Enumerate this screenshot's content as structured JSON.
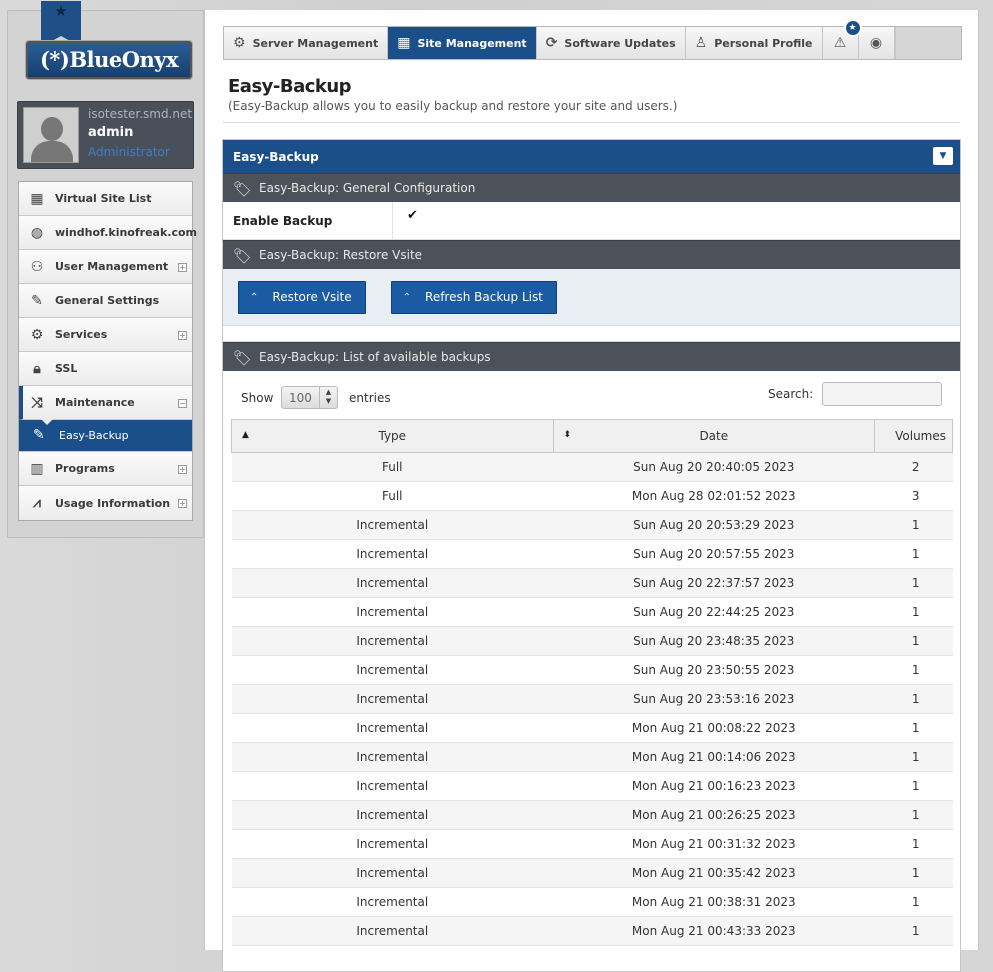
{
  "logo": {
    "text": "(*)BlueOnyx"
  },
  "user": {
    "host": "isotester.smd.net",
    "name": "admin",
    "role": "Administrator"
  },
  "sidebar": {
    "items": [
      {
        "label": "Virtual Site List",
        "icon": "grid-list-icon"
      },
      {
        "label": "windhof.kinofreak.com",
        "icon": "globe-icon"
      },
      {
        "label": "User Management",
        "icon": "users-icon"
      },
      {
        "label": "General Settings",
        "icon": "edit-square-icon"
      },
      {
        "label": "Services",
        "icon": "gear-icon"
      },
      {
        "label": "SSL",
        "icon": "lock-icon"
      },
      {
        "label": "Maintenance",
        "icon": "shuffle-icon"
      },
      {
        "label": "Easy-Backup",
        "icon": "pencil-icon"
      },
      {
        "label": "Programs",
        "icon": "chip-icon"
      },
      {
        "label": "Usage Information",
        "icon": "line-chart-icon"
      }
    ]
  },
  "tabs": [
    {
      "label": "Server Management",
      "icon": "gear-icon"
    },
    {
      "label": "Site Management",
      "icon": "layout-icon"
    },
    {
      "label": "Software Updates",
      "icon": "refresh-icon"
    },
    {
      "label": "Personal Profile",
      "icon": "user-icon"
    }
  ],
  "page": {
    "title": "Easy-Backup",
    "subtitle": "(Easy-Backup allows you to easily backup and restore your site and users.)"
  },
  "panel": {
    "title": "Easy-Backup",
    "sections": {
      "general": "Easy-Backup: General Configuration",
      "restore": "Easy-Backup: Restore Vsite",
      "list": "Easy-Backup: List of available backups"
    },
    "enable_label": "Enable Backup",
    "enable_value": "✔",
    "buttons": {
      "restore": "Restore Vsite",
      "refresh": "Refresh Backup List"
    }
  },
  "table": {
    "show_label": "Show",
    "length_value": "100",
    "entries_label": "entries",
    "search_label": "Search:",
    "columns": [
      "Type",
      "Date",
      "Volumes"
    ],
    "rows": [
      [
        "Full",
        "Sun Aug 20 20:40:05 2023",
        "2"
      ],
      [
        "Full",
        "Mon Aug 28 02:01:52 2023",
        "3"
      ],
      [
        "Incremental",
        "Sun Aug 20 20:53:29 2023",
        "1"
      ],
      [
        "Incremental",
        "Sun Aug 20 20:57:55 2023",
        "1"
      ],
      [
        "Incremental",
        "Sun Aug 20 22:37:57 2023",
        "1"
      ],
      [
        "Incremental",
        "Sun Aug 20 22:44:25 2023",
        "1"
      ],
      [
        "Incremental",
        "Sun Aug 20 23:48:35 2023",
        "1"
      ],
      [
        "Incremental",
        "Sun Aug 20 23:50:55 2023",
        "1"
      ],
      [
        "Incremental",
        "Sun Aug 20 23:53:16 2023",
        "1"
      ],
      [
        "Incremental",
        "Mon Aug 21 00:08:22 2023",
        "1"
      ],
      [
        "Incremental",
        "Mon Aug 21 00:14:06 2023",
        "1"
      ],
      [
        "Incremental",
        "Mon Aug 21 00:16:23 2023",
        "1"
      ],
      [
        "Incremental",
        "Mon Aug 21 00:26:25 2023",
        "1"
      ],
      [
        "Incremental",
        "Mon Aug 21 00:31:32 2023",
        "1"
      ],
      [
        "Incremental",
        "Mon Aug 21 00:35:42 2023",
        "1"
      ],
      [
        "Incremental",
        "Mon Aug 21 00:38:31 2023",
        "1"
      ],
      [
        "Incremental",
        "Mon Aug 21 00:43:33 2023",
        "1"
      ]
    ]
  },
  "colors": {
    "primary": "#1a4f8a",
    "section": "#4b525a"
  }
}
